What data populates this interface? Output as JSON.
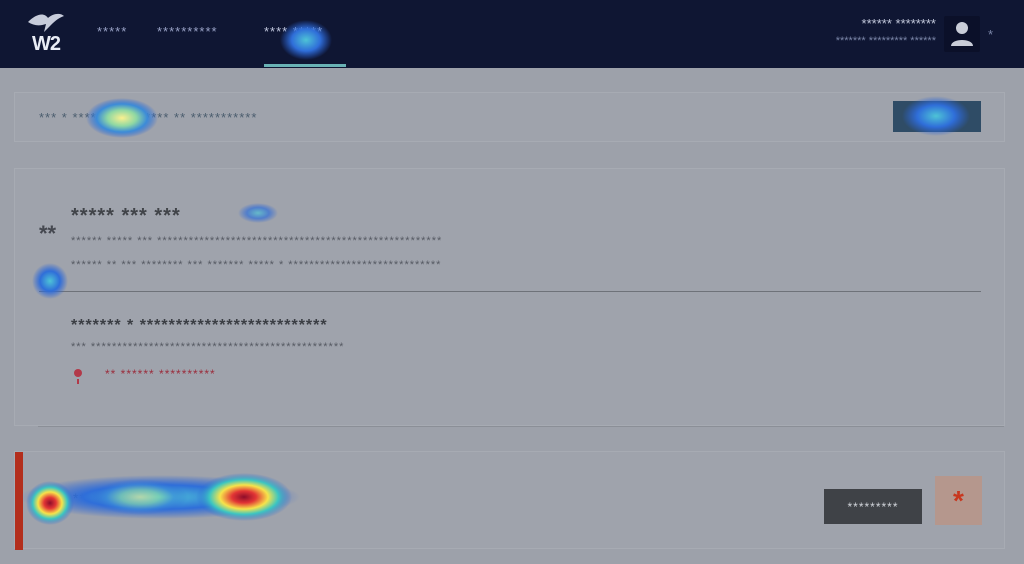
{
  "header": {
    "logo_text": "W2",
    "nav": [
      {
        "label": "*****"
      },
      {
        "label": "**********"
      },
      {
        "label": "**** *****"
      }
    ],
    "user_name": "****** ********",
    "user_sub": "******* ********* ******",
    "user_caret": "*"
  },
  "breadcrumb": {
    "text": "*** * **************** ** ***********"
  },
  "main": {
    "step_number": "**",
    "title": "***** *** ***",
    "desc_1": "****** ***** *** ******************************************************",
    "desc_2": "****** ** *** ******** *** ******* ***** * *****************************",
    "side_link": "***",
    "subtitle": "******* * **************************",
    "subdesc": "*** ************************************************",
    "error_text": "** ****** **********"
  },
  "action": {
    "text": "***** ***** ********* ****",
    "dark_button": "*********",
    "red_button": "*"
  },
  "colors": {
    "header_bg": "#0f1633",
    "accent_teal": "#69b2b5",
    "accent_red": "#b32e1c",
    "error": "#9b2d3c"
  }
}
